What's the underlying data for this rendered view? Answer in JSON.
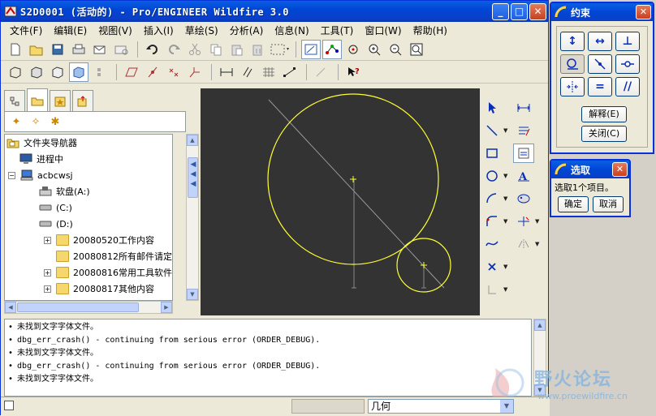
{
  "window": {
    "title": "S2D0001 (活动的) - Pro/ENGINEER Wildfire 3.0",
    "min_glyph": "_",
    "max_glyph": "□",
    "close_glyph": "✕"
  },
  "menu": [
    "文件(F)",
    "编辑(E)",
    "视图(V)",
    "插入(I)",
    "草绘(S)",
    "分析(A)",
    "信息(N)",
    "工具(T)",
    "窗口(W)",
    "帮助(H)"
  ],
  "tree": {
    "root": "文件夹导航器",
    "items": [
      {
        "label": "进程中",
        "icon": "monitor-icon",
        "indent": 1
      },
      {
        "label": "acbcwsj",
        "icon": "computer-icon",
        "indent": 0,
        "expander": "−"
      },
      {
        "label": "软盘(A:)",
        "icon": "floppy-icon",
        "indent": 2
      },
      {
        "label": "(C:)",
        "icon": "drive-icon",
        "indent": 2
      },
      {
        "label": "(D:)",
        "icon": "drive-icon",
        "indent": 2
      },
      {
        "label": "20080520工作内容",
        "icon": "folder-icon",
        "indent": 3,
        "expander": "+"
      },
      {
        "label": "20080812所有邮件请定",
        "icon": "folder-icon",
        "indent": 3
      },
      {
        "label": "20080816常用工具软件",
        "icon": "folder-icon",
        "indent": 3,
        "expander": "+"
      },
      {
        "label": "20080817其他内容",
        "icon": "folder-icon",
        "indent": 3,
        "expander": "+"
      }
    ]
  },
  "messages": [
    "未找到文字字体文件。",
    "dbg_err_crash() - continuing from serious error (ORDER_DEBUG).",
    "未找到文字字体文件。",
    "dbg_err_crash() - continuing from serious error (ORDER_DEBUG).",
    "未找到文字字体文件。"
  ],
  "status": {
    "filter_value": "几何"
  },
  "constraints_dialog": {
    "title": "约束",
    "explain_label": "解释(E)",
    "close_label": "关闭(C)",
    "buttons": [
      "vertical-constraint-icon",
      "horizontal-constraint-icon",
      "perpendicular-constraint-icon",
      "tangent-constraint-icon",
      "point-on-entity-icon",
      "midpoint-constraint-icon",
      "symmetric-constraint-icon",
      "equal-constraint-icon",
      "parallel-constraint-icon"
    ]
  },
  "select_dialog": {
    "title": "选取",
    "message": "选取1个项目。",
    "ok_label": "确定",
    "cancel_label": "取消"
  },
  "watermark": {
    "name": "野火论坛",
    "url": "www.proewildfire.cn"
  },
  "colors": {
    "canvas_bg": "#333333",
    "sketch_yellow": "#ffff33",
    "titlebar_blue": "#0046d5"
  }
}
